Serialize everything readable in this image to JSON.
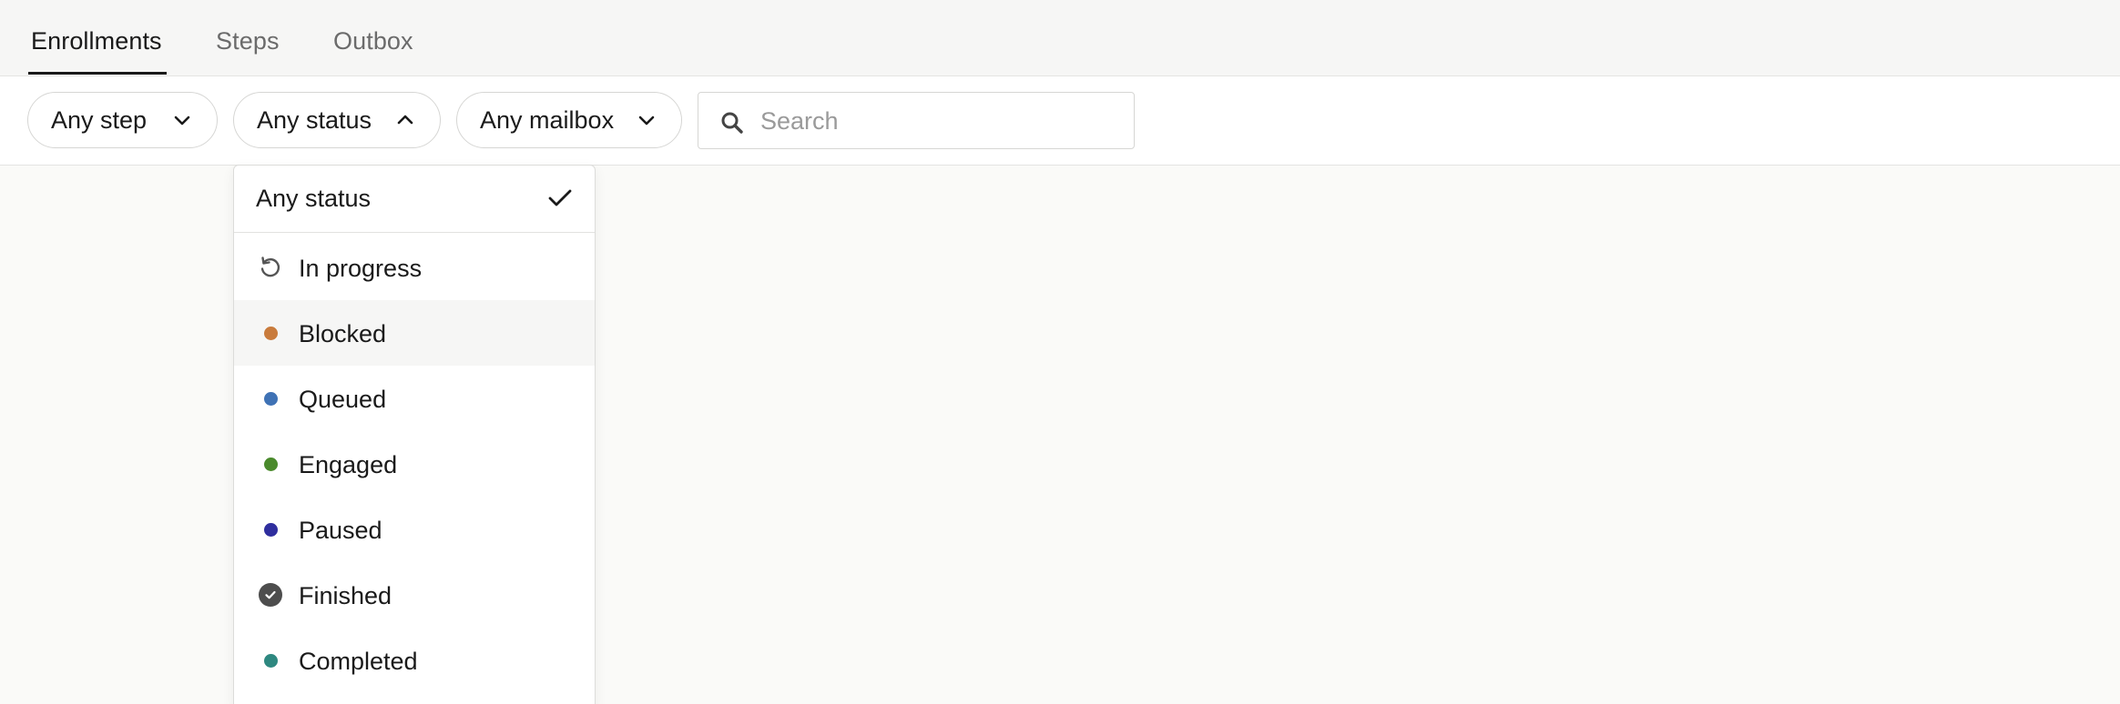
{
  "tabs": [
    {
      "label": "Enrollments",
      "active": true
    },
    {
      "label": "Steps",
      "active": false
    },
    {
      "label": "Outbox",
      "active": false
    }
  ],
  "filters": {
    "step": {
      "value": "Any step",
      "icon": "chevron-down-icon"
    },
    "status": {
      "value": "Any status",
      "icon": "chevron-up-icon",
      "open": true
    },
    "mailbox": {
      "value": "Any mailbox",
      "icon": "chevron-down-icon"
    }
  },
  "search": {
    "placeholder": "Search",
    "value": "",
    "icon": "search-icon"
  },
  "status_dropdown": {
    "selected": {
      "label": "Any status",
      "icon": "checkmark-icon"
    },
    "options": [
      {
        "label": "In progress",
        "icon": "refresh-icon",
        "color": "#555555"
      },
      {
        "label": "Blocked",
        "icon": "dot",
        "color": "#c97b3c",
        "hovered": true
      },
      {
        "label": "Queued",
        "icon": "dot",
        "color": "#3f72b5"
      },
      {
        "label": "Engaged",
        "icon": "dot",
        "color": "#4a8a2c"
      },
      {
        "label": "Paused",
        "icon": "dot",
        "color": "#2f2e9e"
      },
      {
        "label": "Finished",
        "icon": "check-circle-icon",
        "color": "#4d4d4d"
      },
      {
        "label": "Completed",
        "icon": "dot",
        "color": "#2e8880"
      }
    ]
  }
}
